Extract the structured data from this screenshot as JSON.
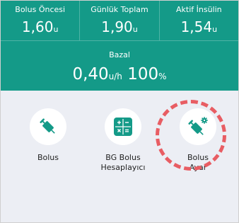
{
  "stats": [
    {
      "label": "Bolus Öncesi",
      "value": "1,60",
      "unit": "u"
    },
    {
      "label": "Günlük Toplam",
      "value": "1,90",
      "unit": "u"
    },
    {
      "label": "Aktif İnsülin",
      "value": "1,54",
      "unit": "u"
    }
  ],
  "basal": {
    "label": "Bazal",
    "value": "0,40",
    "unit": "u/h",
    "percent": "100",
    "percent_unit": "%"
  },
  "actions": [
    {
      "label": "Bolus",
      "icon": "syringe-icon"
    },
    {
      "label": "BG Bolus Hesaplayıcı",
      "icon": "calculator-icon"
    },
    {
      "label": "Bolus Ayar",
      "icon": "syringe-gear-icon"
    }
  ],
  "colors": {
    "header": "#149a88",
    "background": "#eceef4",
    "highlight": "#e85d63"
  }
}
